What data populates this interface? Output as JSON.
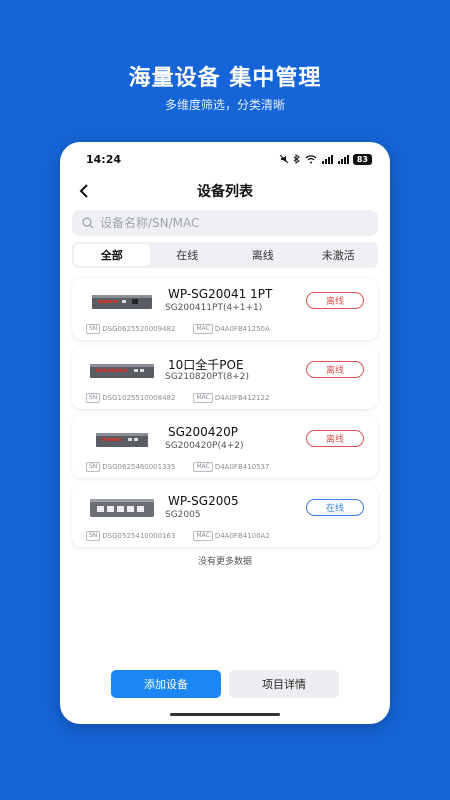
{
  "promo": {
    "title": "海量设备 集中管理",
    "subtitle": "多维度筛选，分类清晰"
  },
  "statusbar": {
    "time": "14:24",
    "icons": [
      "mute-icon",
      "bluetooth-icon",
      "wifi-icon",
      "signal-icon",
      "signal-icon"
    ],
    "battery": "83"
  },
  "nav": {
    "title": "设备列表"
  },
  "search": {
    "placeholder": "设备名称/SN/MAC",
    "value": ""
  },
  "tabs": [
    {
      "label": "全部",
      "active": true
    },
    {
      "label": "在线",
      "active": false
    },
    {
      "label": "离线",
      "active": false
    },
    {
      "label": "未激活",
      "active": false
    }
  ],
  "labels": {
    "sn_tag": "SN",
    "mac_tag": "MAC"
  },
  "devices": [
    {
      "name": "WP-SG20041 1PT",
      "model": "SG200411PT(4+1+1)",
      "status": "离线",
      "status_type": "offline",
      "sn": "DSG0625520009482",
      "mac": "D4A0FB41250A"
    },
    {
      "name": "10口全千POE",
      "model": "SG210820PT(8+2)",
      "status": "离线",
      "status_type": "offline",
      "sn": "DSG1025510008482",
      "mac": "D4A0FB412122"
    },
    {
      "name": "SG200420P",
      "model": "SG200420P(4+2)",
      "status": "离线",
      "status_type": "offline",
      "sn": "DSG0625460001335",
      "mac": "D4A0FB410537"
    },
    {
      "name": "WP-SG2005",
      "model": "SG2005",
      "status": "在线",
      "status_type": "online",
      "sn": "DSG0525410000163",
      "mac": "D4A0FB4100A2"
    }
  ],
  "list_footer": "没有更多数据",
  "buttons": {
    "add": "添加设备",
    "details": "项目详情"
  },
  "colors": {
    "background": "#1565d8",
    "primary": "#1b87f5",
    "offline": "#d9534f",
    "online": "#3b7ee0"
  }
}
